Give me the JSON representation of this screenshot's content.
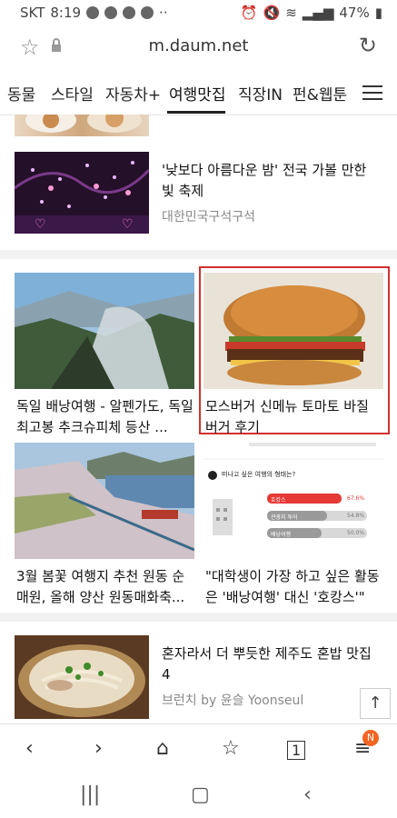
{
  "status": {
    "carrier": "SKT",
    "time": "8:19",
    "battery": "47%"
  },
  "browser": {
    "url": "m.daum.net"
  },
  "tabs": [
    "동물",
    "스타일",
    "자동차+",
    "여행맛집",
    "직장IN",
    "펀&웹툰"
  ],
  "articles": {
    "a1": {
      "title": "'낮보다 아름다운 밤' 전국 가볼 만한 빛 축제",
      "source": "대한민국구석구석"
    },
    "g1": {
      "title": "독일 배낭여행 - 알펜가도, 독일 최고봉 추크슈피체 등산 ..."
    },
    "g2": {
      "title": "모스버거 신메뉴 토마토 바질 버거 후기"
    },
    "g3": {
      "title": "3월 봄꽃 여행지 추천 원동 순매원, 올해 양산 원동매화축..."
    },
    "g4": {
      "title": "\"대학생이 가장 하고 싶은 활동은 '배낭여행' 대신 '호캉스'\""
    },
    "a2": {
      "title": "혼자라서 더 뿌듯한 제주도 혼밥 맛집 4",
      "source": "브런치 by 윤슬 Yoonseul"
    }
  },
  "infographic": {
    "question": "떠나고 싶은 여행의 형태는?",
    "rows": [
      {
        "label": "호캉스",
        "value": "67.6%"
      },
      {
        "label": "관광지 투어",
        "value": "54.8%"
      },
      {
        "label": "배낭여행",
        "value": "50.0%"
      }
    ]
  },
  "bottom": {
    "badge": "N"
  },
  "colors": {
    "highlight": "#d32f2f",
    "badge": "#f26522"
  }
}
